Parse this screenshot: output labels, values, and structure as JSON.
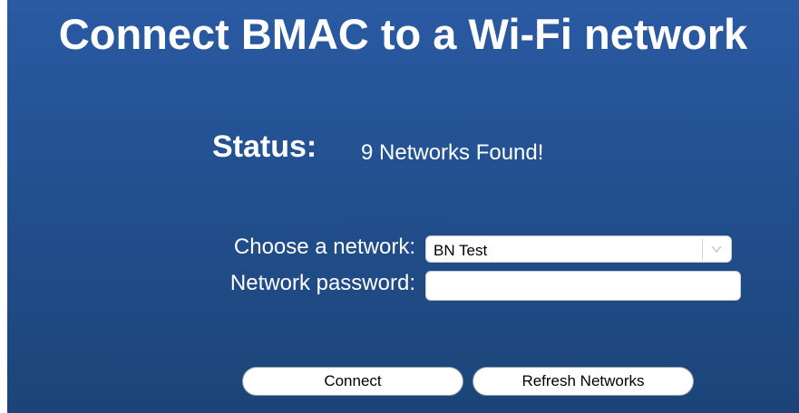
{
  "title": "Connect BMAC to a Wi-Fi network",
  "status": {
    "label": "Status:",
    "value": "9 Networks Found!"
  },
  "form": {
    "network_label": "Choose a network:",
    "network_selected": "BN Test",
    "network_dropdown_icon": "chevron-down-icon",
    "password_label": "Network password:",
    "password_value": ""
  },
  "buttons": {
    "connect": "Connect",
    "refresh": "Refresh Networks"
  },
  "colors": {
    "background_top": "#2a5aa3",
    "background_bottom": "#1c4478",
    "text": "#ffffff"
  }
}
